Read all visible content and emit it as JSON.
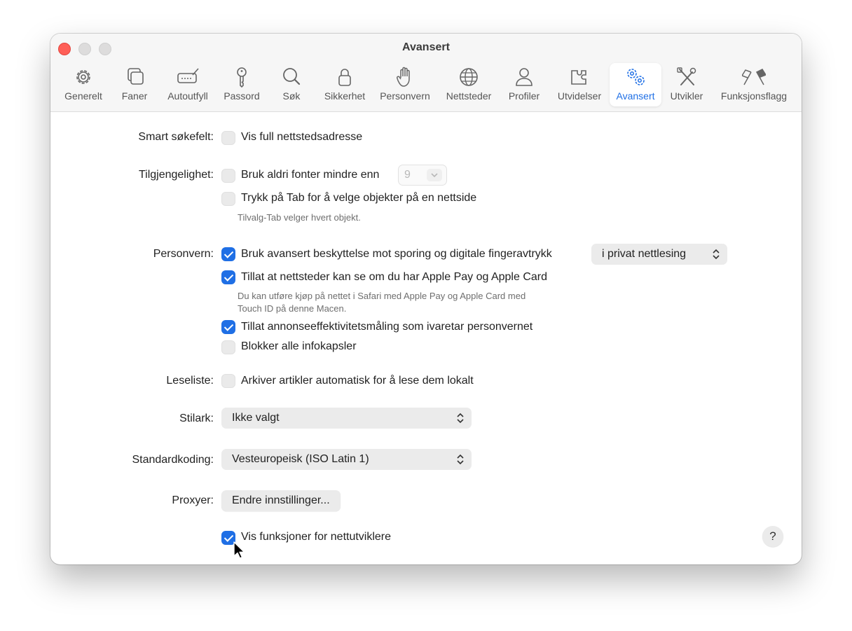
{
  "window": {
    "title": "Avansert"
  },
  "toolbar": {
    "items": [
      {
        "label": "Generelt",
        "icon": "gear-icon"
      },
      {
        "label": "Faner",
        "icon": "tabs-icon"
      },
      {
        "label": "Autoutfyll",
        "icon": "autofill-icon"
      },
      {
        "label": "Passord",
        "icon": "key-icon"
      },
      {
        "label": "Søk",
        "icon": "search-icon"
      },
      {
        "label": "Sikkerhet",
        "icon": "lock-icon"
      },
      {
        "label": "Personvern",
        "icon": "hand-icon"
      },
      {
        "label": "Nettsteder",
        "icon": "globe-icon"
      },
      {
        "label": "Profiler",
        "icon": "person-icon"
      },
      {
        "label": "Utvidelser",
        "icon": "puzzle-icon"
      },
      {
        "label": "Avansert",
        "icon": "gears-icon",
        "active": true
      },
      {
        "label": "Utvikler",
        "icon": "tools-icon"
      },
      {
        "label": "Funksjonsflagg",
        "icon": "flags-icon"
      }
    ]
  },
  "smart_search": {
    "label": "Smart søkefelt:",
    "option": "Vis full nettstedsadresse",
    "checked": false
  },
  "accessibility": {
    "label": "Tilgjengelighet:",
    "min_font": {
      "text": "Bruk aldri fonter mindre enn",
      "checked": false,
      "value": "9"
    },
    "tab_option": {
      "text": "Trykk på Tab for å velge objekter på en nettside",
      "checked": false
    },
    "hint": "Tilvalg-Tab velger hvert objekt."
  },
  "privacy": {
    "label": "Personvern:",
    "tracking": {
      "text": "Bruk avansert beskyttelse mot sporing og digitale fingeravtrykk",
      "checked": true
    },
    "tracking_popup": "i privat nettlesing",
    "apple_pay": {
      "text": "Tillat at nettsteder kan se om du har Apple Pay og Apple Card",
      "checked": true
    },
    "apple_pay_hint_1": "Du kan utføre kjøp på nettet i Safari med Apple Pay og Apple Card med",
    "apple_pay_hint_2": "Touch ID på denne Macen.",
    "ad_measure": {
      "text": "Tillat annonseeffektivitetsmåling som ivaretar personvernet",
      "checked": true
    },
    "block_cookies": {
      "text": "Blokker alle infokapsler",
      "checked": false
    }
  },
  "reading_list": {
    "label": "Leseliste:",
    "option": "Arkiver artikler automatisk for å lese dem lokalt",
    "checked": false
  },
  "stylesheet": {
    "label": "Stilark:",
    "value": "Ikke valgt"
  },
  "encoding": {
    "label": "Standardkoding:",
    "value": "Vesteuropeisk (ISO Latin 1)"
  },
  "proxies": {
    "label": "Proxyer:",
    "button": "Endre innstillinger..."
  },
  "developer": {
    "option": "Vis funksjoner for nettutviklere",
    "checked": true
  },
  "help": {
    "label": "?"
  },
  "colors": {
    "accent": "#1f6fe5",
    "close": "#ff5f57"
  }
}
